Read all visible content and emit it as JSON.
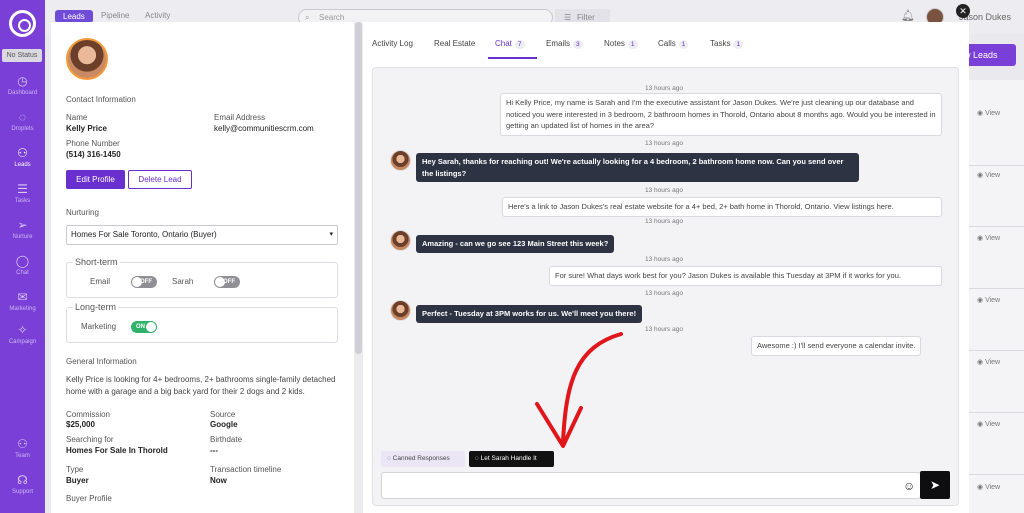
{
  "nav": {
    "status": "No Status",
    "items": [
      {
        "label": "Dashboard",
        "icon": "dashboard-icon",
        "glyph": "◷"
      },
      {
        "label": "Droplets",
        "icon": "droplet-icon",
        "glyph": "◌"
      },
      {
        "label": "Leads",
        "icon": "leads-icon",
        "glyph": "⚇"
      },
      {
        "label": "Tasks",
        "icon": "tasks-icon",
        "glyph": "☰"
      },
      {
        "label": "Nurture",
        "icon": "nurture-icon",
        "glyph": "➢"
      },
      {
        "label": "Chat",
        "icon": "chat-icon",
        "glyph": "◯"
      },
      {
        "label": "Marketing",
        "icon": "marketing-icon",
        "glyph": "✉"
      },
      {
        "label": "Campaign",
        "icon": "campaign-icon",
        "glyph": "✧"
      },
      {
        "label": "Team",
        "icon": "team-icon",
        "glyph": "⚇"
      },
      {
        "label": "Support",
        "icon": "support-icon",
        "glyph": "☊"
      }
    ]
  },
  "topbar": {
    "tabs": [
      "Leads",
      "Pipeline",
      "Activity"
    ],
    "search_placeholder": "Search",
    "filter_label": "Filter",
    "user_name": "Jason Dukes",
    "new_leads_label": "w Leads",
    "view_label": "View"
  },
  "contact": {
    "section_title": "Contact Information",
    "name_label": "Name",
    "name": "Kelly Price",
    "email_label": "Email Address",
    "email": "kelly@communitiescrm.com",
    "phone_label": "Phone Number",
    "phone": "(514) 316-1450",
    "edit_button": "Edit Profile",
    "delete_button": "Delete Lead"
  },
  "nurturing": {
    "title": "Nurturing",
    "selected": "Homes For Sale Toronto, Ontario (Buyer)",
    "short_term": "Short-term",
    "email_label": "Email",
    "email_toggle": "OFF",
    "sarah_label": "Sarah",
    "sarah_toggle": "OFF",
    "long_term": "Long-term",
    "marketing_label": "Marketing",
    "marketing_toggle": "ON"
  },
  "general": {
    "title": "General Information",
    "description": "Kelly Price is looking for 4+ bedrooms, 2+ bathrooms single-family detached home with a garage and a big back yard for their 2 dogs and 2 kids.",
    "commission_label": "Commission",
    "commission": "$25,000",
    "source_label": "Source",
    "source": "Google",
    "searching_label": "Searching for",
    "searching": "Homes For Sale In Thorold",
    "birthdate_label": "Birthdate",
    "birthdate": "---",
    "type_label": "Type",
    "type": "Buyer",
    "timeline_label": "Transaction timeline",
    "timeline": "Now",
    "buyer_profile": "Buyer Profile"
  },
  "tabs": [
    {
      "label": "Activity Log",
      "count": ""
    },
    {
      "label": "Real Estate",
      "count": ""
    },
    {
      "label": "Chat",
      "count": "7"
    },
    {
      "label": "Emails",
      "count": "3"
    },
    {
      "label": "Notes",
      "count": "1"
    },
    {
      "label": "Calls",
      "count": "1"
    },
    {
      "label": "Tasks",
      "count": "1"
    }
  ],
  "chat": {
    "timestamp": "13 hours ago",
    "messages": [
      {
        "dir": "out",
        "text": "Hi Kelly Price, my name is Sarah and I'm the executive assistant for Jason Dukes. We're just cleaning up our database and noticed you were interested in 3 bedroom, 2 bathroom homes in Thorold, Ontario about 8 months ago. Would you be interested in getting an updated list of homes in the area?"
      },
      {
        "dir": "in",
        "text": "Hey Sarah, thanks for reaching out! We're actually looking for a 4 bedroom, 2 bathroom home now. Can you send over the listings?"
      },
      {
        "dir": "out",
        "text": "Here's a link to Jason Dukes's real estate website for a 4+ bed, 2+ bath home in Thorold, Ontario. View listings here."
      },
      {
        "dir": "in",
        "text": "Amazing - can we go see 123 Main Street this week?"
      },
      {
        "dir": "out",
        "text": "For sure! What days work best for you? Jason Dukes is available this Tuesday at 3PM if it works for you."
      },
      {
        "dir": "in",
        "text": "Perfect - Tuesday at 3PM works for us. We'll meet you there!"
      },
      {
        "dir": "out",
        "text": "Awesome :) I'll send everyone a calendar invite."
      }
    ],
    "canned_label": "Canned Responses",
    "sarah_label": "Let Sarah Handle It",
    "input_placeholder": ""
  },
  "colors": {
    "accent": "#6a2fcf",
    "nav": "#7a3fd6",
    "arrow": "#e0161b"
  }
}
